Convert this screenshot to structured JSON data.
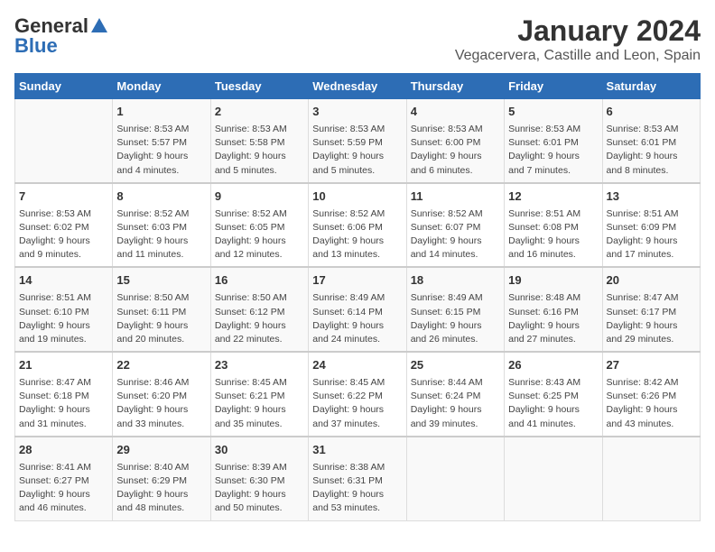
{
  "logo": {
    "general": "General",
    "blue": "Blue"
  },
  "title": "January 2024",
  "location": "Vegacervera, Castille and Leon, Spain",
  "days_of_week": [
    "Sunday",
    "Monday",
    "Tuesday",
    "Wednesday",
    "Thursday",
    "Friday",
    "Saturday"
  ],
  "weeks": [
    [
      {
        "day": "",
        "info": ""
      },
      {
        "day": "1",
        "info": "Sunrise: 8:53 AM\nSunset: 5:57 PM\nDaylight: 9 hours\nand 4 minutes."
      },
      {
        "day": "2",
        "info": "Sunrise: 8:53 AM\nSunset: 5:58 PM\nDaylight: 9 hours\nand 5 minutes."
      },
      {
        "day": "3",
        "info": "Sunrise: 8:53 AM\nSunset: 5:59 PM\nDaylight: 9 hours\nand 5 minutes."
      },
      {
        "day": "4",
        "info": "Sunrise: 8:53 AM\nSunset: 6:00 PM\nDaylight: 9 hours\nand 6 minutes."
      },
      {
        "day": "5",
        "info": "Sunrise: 8:53 AM\nSunset: 6:01 PM\nDaylight: 9 hours\nand 7 minutes."
      },
      {
        "day": "6",
        "info": "Sunrise: 8:53 AM\nSunset: 6:01 PM\nDaylight: 9 hours\nand 8 minutes."
      }
    ],
    [
      {
        "day": "7",
        "info": "Sunrise: 8:53 AM\nSunset: 6:02 PM\nDaylight: 9 hours\nand 9 minutes."
      },
      {
        "day": "8",
        "info": "Sunrise: 8:52 AM\nSunset: 6:03 PM\nDaylight: 9 hours\nand 11 minutes."
      },
      {
        "day": "9",
        "info": "Sunrise: 8:52 AM\nSunset: 6:05 PM\nDaylight: 9 hours\nand 12 minutes."
      },
      {
        "day": "10",
        "info": "Sunrise: 8:52 AM\nSunset: 6:06 PM\nDaylight: 9 hours\nand 13 minutes."
      },
      {
        "day": "11",
        "info": "Sunrise: 8:52 AM\nSunset: 6:07 PM\nDaylight: 9 hours\nand 14 minutes."
      },
      {
        "day": "12",
        "info": "Sunrise: 8:51 AM\nSunset: 6:08 PM\nDaylight: 9 hours\nand 16 minutes."
      },
      {
        "day": "13",
        "info": "Sunrise: 8:51 AM\nSunset: 6:09 PM\nDaylight: 9 hours\nand 17 minutes."
      }
    ],
    [
      {
        "day": "14",
        "info": "Sunrise: 8:51 AM\nSunset: 6:10 PM\nDaylight: 9 hours\nand 19 minutes."
      },
      {
        "day": "15",
        "info": "Sunrise: 8:50 AM\nSunset: 6:11 PM\nDaylight: 9 hours\nand 20 minutes."
      },
      {
        "day": "16",
        "info": "Sunrise: 8:50 AM\nSunset: 6:12 PM\nDaylight: 9 hours\nand 22 minutes."
      },
      {
        "day": "17",
        "info": "Sunrise: 8:49 AM\nSunset: 6:14 PM\nDaylight: 9 hours\nand 24 minutes."
      },
      {
        "day": "18",
        "info": "Sunrise: 8:49 AM\nSunset: 6:15 PM\nDaylight: 9 hours\nand 26 minutes."
      },
      {
        "day": "19",
        "info": "Sunrise: 8:48 AM\nSunset: 6:16 PM\nDaylight: 9 hours\nand 27 minutes."
      },
      {
        "day": "20",
        "info": "Sunrise: 8:47 AM\nSunset: 6:17 PM\nDaylight: 9 hours\nand 29 minutes."
      }
    ],
    [
      {
        "day": "21",
        "info": "Sunrise: 8:47 AM\nSunset: 6:18 PM\nDaylight: 9 hours\nand 31 minutes."
      },
      {
        "day": "22",
        "info": "Sunrise: 8:46 AM\nSunset: 6:20 PM\nDaylight: 9 hours\nand 33 minutes."
      },
      {
        "day": "23",
        "info": "Sunrise: 8:45 AM\nSunset: 6:21 PM\nDaylight: 9 hours\nand 35 minutes."
      },
      {
        "day": "24",
        "info": "Sunrise: 8:45 AM\nSunset: 6:22 PM\nDaylight: 9 hours\nand 37 minutes."
      },
      {
        "day": "25",
        "info": "Sunrise: 8:44 AM\nSunset: 6:24 PM\nDaylight: 9 hours\nand 39 minutes."
      },
      {
        "day": "26",
        "info": "Sunrise: 8:43 AM\nSunset: 6:25 PM\nDaylight: 9 hours\nand 41 minutes."
      },
      {
        "day": "27",
        "info": "Sunrise: 8:42 AM\nSunset: 6:26 PM\nDaylight: 9 hours\nand 43 minutes."
      }
    ],
    [
      {
        "day": "28",
        "info": "Sunrise: 8:41 AM\nSunset: 6:27 PM\nDaylight: 9 hours\nand 46 minutes."
      },
      {
        "day": "29",
        "info": "Sunrise: 8:40 AM\nSunset: 6:29 PM\nDaylight: 9 hours\nand 48 minutes."
      },
      {
        "day": "30",
        "info": "Sunrise: 8:39 AM\nSunset: 6:30 PM\nDaylight: 9 hours\nand 50 minutes."
      },
      {
        "day": "31",
        "info": "Sunrise: 8:38 AM\nSunset: 6:31 PM\nDaylight: 9 hours\nand 53 minutes."
      },
      {
        "day": "",
        "info": ""
      },
      {
        "day": "",
        "info": ""
      },
      {
        "day": "",
        "info": ""
      }
    ]
  ]
}
